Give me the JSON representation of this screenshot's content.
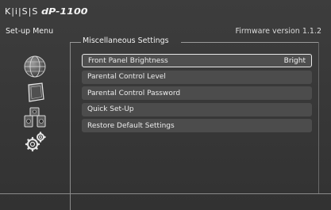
{
  "brand": {
    "logo": "K|i|S|S",
    "model": "dP-1100"
  },
  "header": {
    "menu_label": "Set-up Menu",
    "firmware": "Firmware version 1.1.2",
    "section_title": "Miscellaneous Settings"
  },
  "side_icons": [
    {
      "name": "globe-icon"
    },
    {
      "name": "screen-icon"
    },
    {
      "name": "speakers-icon"
    },
    {
      "name": "gears-icon"
    }
  ],
  "menu": {
    "items": [
      {
        "label": "Front Panel Brightness",
        "value": "Bright",
        "selected": true
      },
      {
        "label": "Parental Control Level",
        "value": ""
      },
      {
        "label": "Parental Control Password",
        "value": ""
      },
      {
        "label": "Quick Set-Up",
        "value": ""
      },
      {
        "label": "Restore Default Settings",
        "value": ""
      }
    ]
  }
}
